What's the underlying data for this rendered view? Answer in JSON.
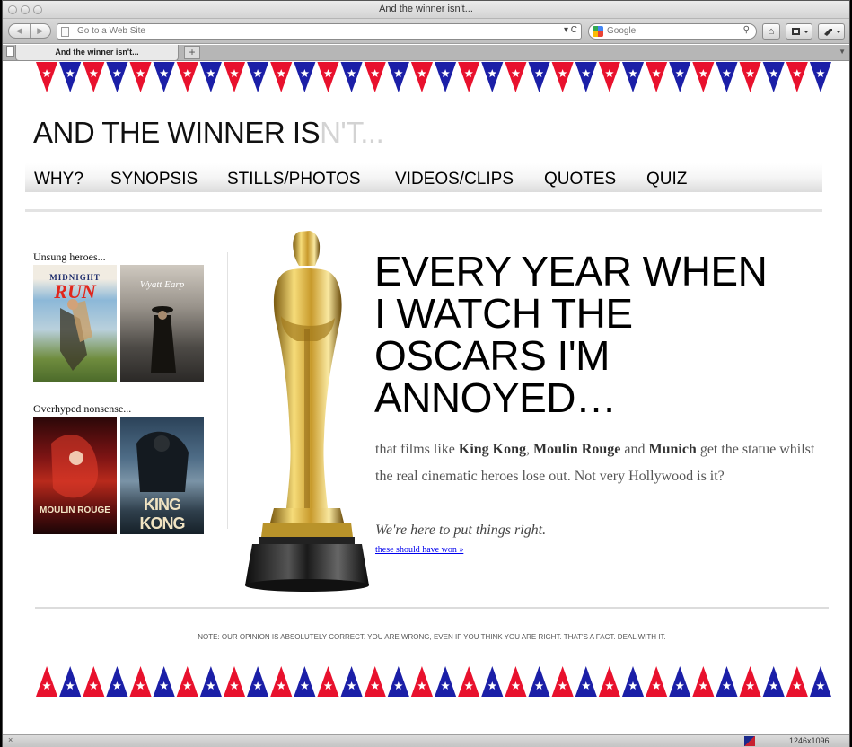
{
  "browser": {
    "window_title": "And the winner isn't...",
    "url_placeholder": "Go to a Web Site",
    "url_controls": "▾ C",
    "search_placeholder": "Google",
    "search_glyph": "⚲",
    "tab_label": "And the winner isn't...",
    "new_tab_label": "+",
    "nav_back": "◀",
    "nav_forward": "▶",
    "home_glyph": "⌂",
    "status_close": "×",
    "status_size": "1246x1096"
  },
  "site": {
    "title_main": "AND THE WINNER IS",
    "title_faded": "N'T...",
    "nav": [
      "WHY?",
      "SYNOPSIS",
      "STILLS/PHOTOS",
      "VIDEOS/CLIPS",
      "QUOTES",
      "QUIZ"
    ],
    "sidebar": {
      "heroes_heading": "Unsung heroes...",
      "overhyped_heading": "Overhyped nonsense...",
      "posters": {
        "midnight_run_title": "MIDNIGHT",
        "midnight_run_word": "RUN",
        "wyatt_earp_title": "Wyatt Earp",
        "moulin_rouge_title": "MOULIN ROUGE",
        "king_kong_title": "KING KONG"
      }
    },
    "headline": "EVERY YEAR WHEN I WATCH THE OSCARS I'M ANNOYED…",
    "blurb": {
      "p1": "that films like ",
      "film1": "King Kong",
      "p2": ", ",
      "film2": "Moulin Rouge",
      "p3": " and ",
      "film3": "Munich",
      "p4": " get the statue whilst the real cinematic heroes lose out. Not very Hollywood is it?"
    },
    "tagline": "We're here to put things right.",
    "cta_link": "these should have won »",
    "note": "NOTE: OUR OPINION IS ABSOLUTELY CORRECT. YOU ARE WRONG, EVEN IF YOU THINK YOU ARE RIGHT. THAT'S A FACT. DEAL WITH IT."
  },
  "colors": {
    "flag_red": "#e8112d",
    "flag_blue": "#1b1fa7",
    "star": "#ffffff",
    "link": "#0000ee"
  }
}
